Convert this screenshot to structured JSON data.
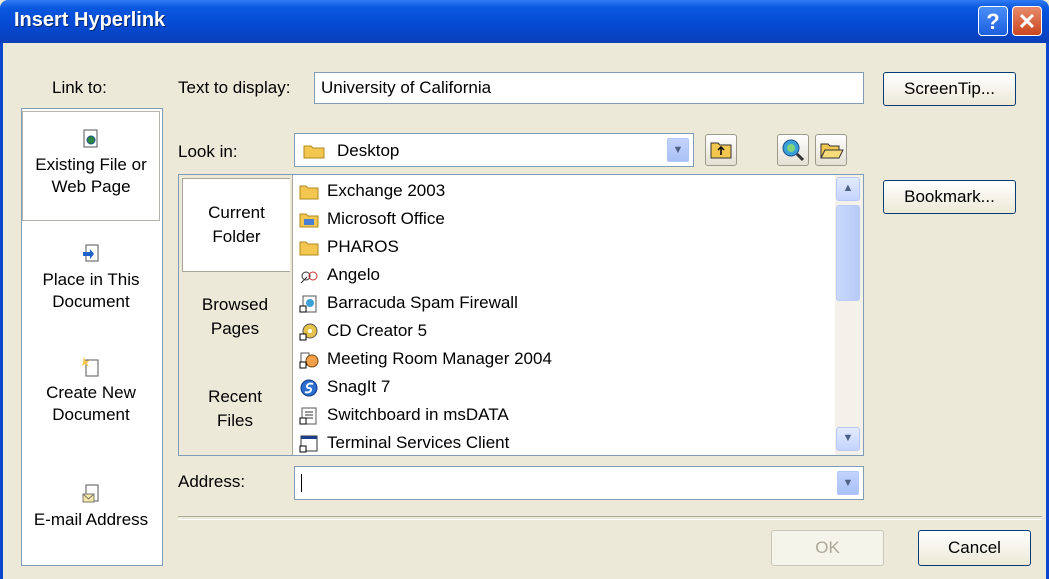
{
  "window": {
    "title": "Insert Hyperlink",
    "help_glyph": "?",
    "close_glyph": "✕"
  },
  "link_to": {
    "header": "Link to:",
    "items": [
      {
        "line1": "Existing File or",
        "line2": "Web Page",
        "icon": "existing-file-icon",
        "selected": true
      },
      {
        "line1": "Place in This",
        "line2": "Document",
        "icon": "place-in-document-icon",
        "selected": false
      },
      {
        "line1": "Create New",
        "line2": "Document",
        "icon": "create-new-document-icon",
        "selected": false
      },
      {
        "line1": "E-mail Address",
        "line2": "",
        "icon": "email-address-icon",
        "selected": false
      }
    ]
  },
  "text_to_display": {
    "label": "Text to display:",
    "value": "University of California"
  },
  "screentip": {
    "label": "ScreenTip..."
  },
  "look_in": {
    "label": "Look in:",
    "value": "Desktop"
  },
  "tabs": [
    {
      "line1": "Current",
      "line2": "Folder",
      "selected": true
    },
    {
      "line1": "Browsed",
      "line2": "Pages",
      "selected": false
    },
    {
      "line1": "Recent",
      "line2": "Files",
      "selected": false
    }
  ],
  "files": [
    {
      "name": "Exchange 2003",
      "icon": "folder-icon"
    },
    {
      "name": "Microsoft Office",
      "icon": "folder-programs-icon"
    },
    {
      "name": "PHAROS",
      "icon": "folder-icon"
    },
    {
      "name": "Angelo",
      "icon": "shortcut-network-icon"
    },
    {
      "name": "Barracuda Spam Firewall",
      "icon": "shortcut-web-icon"
    },
    {
      "name": "CD Creator 5",
      "icon": "shortcut-cd-icon"
    },
    {
      "name": "Meeting Room Manager 2004",
      "icon": "shortcut-clock-icon"
    },
    {
      "name": "SnagIt 7",
      "icon": "snagit-icon"
    },
    {
      "name": "Switchboard in msDATA",
      "icon": "shortcut-form-icon"
    },
    {
      "name": "Terminal Services Client",
      "icon": "shortcut-terminal-icon"
    }
  ],
  "bookmark": {
    "label": "Bookmark..."
  },
  "address": {
    "label": "Address:",
    "value": ""
  },
  "ok": {
    "label": "OK"
  },
  "cancel": {
    "label": "Cancel"
  },
  "colors": {
    "titlebar": "#0449d2",
    "dialog_bg": "#ece9d8",
    "field_border": "#7f9db9",
    "folder": "#f3c74f"
  }
}
